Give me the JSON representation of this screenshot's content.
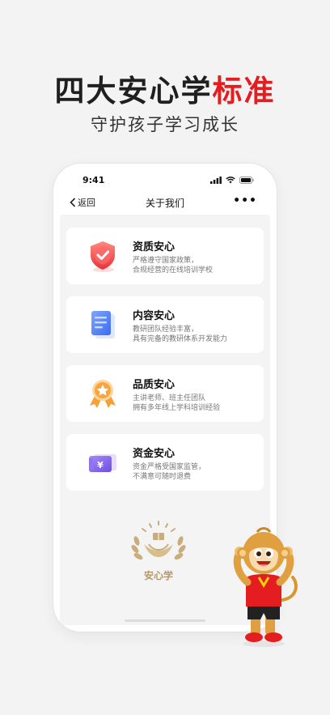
{
  "hero": {
    "title_main": "四大安心学",
    "title_accent": "标准",
    "subtitle": "守护孩子学习成长"
  },
  "status_bar": {
    "time": "9:41"
  },
  "nav": {
    "back_label": "返回",
    "title": "关于我们",
    "more_label": "•••"
  },
  "cards": [
    {
      "title": "资质安心",
      "desc_line1": "严格遵守国家政策，",
      "desc_line2": "合规经营的在线培训学校",
      "icon": "shield-check-icon"
    },
    {
      "title": "内容安心",
      "desc_line1": "教研团队经验丰富，",
      "desc_line2": "具有完备的教研体系开发能力",
      "icon": "book-icon"
    },
    {
      "title": "品质安心",
      "desc_line1": "主讲老师、班主任团队",
      "desc_line2": "拥有多年线上学科培训经验",
      "icon": "medal-icon"
    },
    {
      "title": "资金安心",
      "desc_line1": "资金严格受国家监管，",
      "desc_line2": "不满意可随时退费",
      "icon": "money-card-icon"
    }
  ],
  "logo": {
    "text": "安心学"
  },
  "colors": {
    "accent": "#e41d20",
    "gold": "#b59868"
  }
}
